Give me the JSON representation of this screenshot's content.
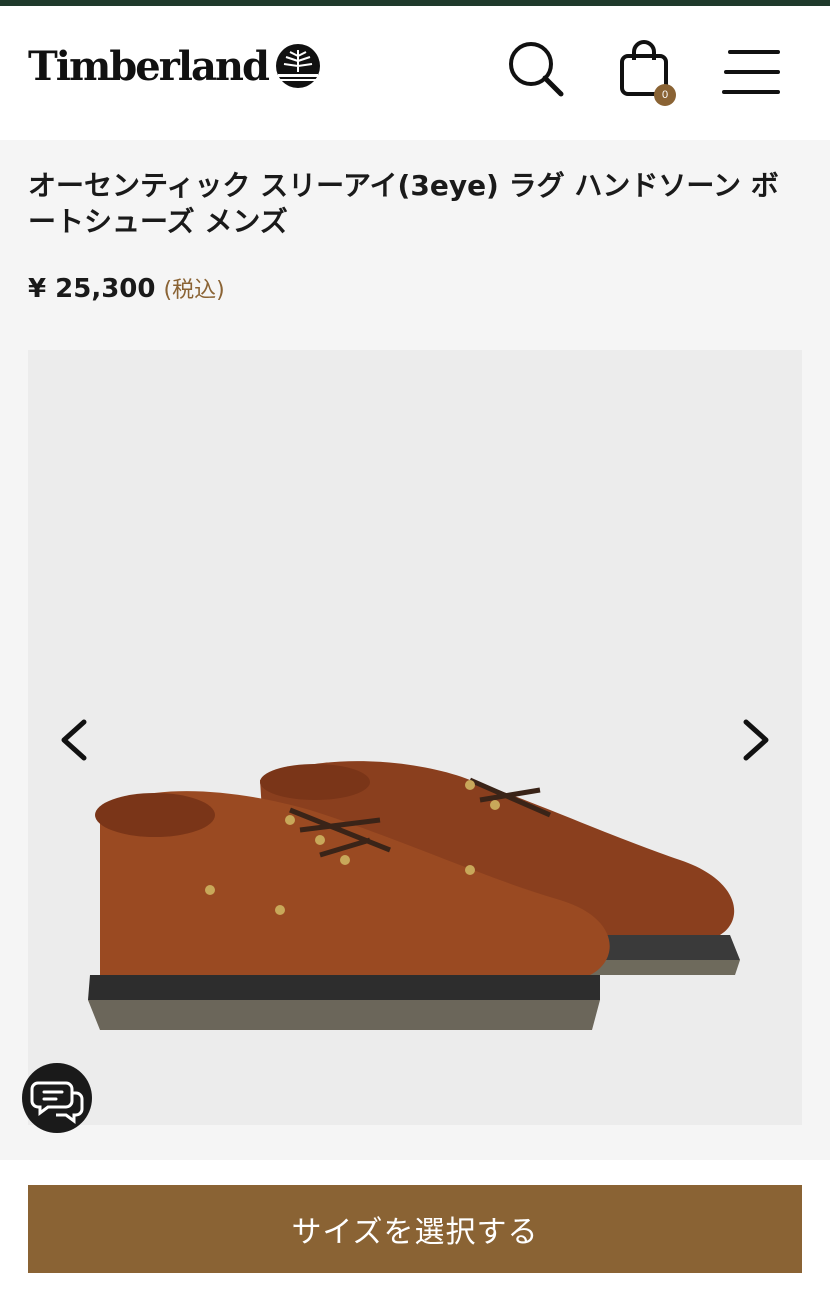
{
  "header": {
    "brand": "Timberland",
    "cart_count": "0",
    "icons": [
      "search-icon",
      "shopping-bag-icon",
      "menu-icon"
    ]
  },
  "product": {
    "title": "オーセンティック スリーアイ(3eye) ラグ ハンドソーン ボートシューズ メンズ",
    "price": "¥ 25,300",
    "tax_note": "(税込)"
  },
  "gallery": {
    "image_alt": "brown woven leather boat shoes",
    "prev_icon": "chevron-left-icon",
    "next_icon": "chevron-right-icon"
  },
  "chat": {
    "icon": "chat-icon"
  },
  "cta": {
    "label": "サイズを選択する"
  },
  "colors": {
    "accent": "#8a6334",
    "topbar": "#1f3a2b",
    "text": "#1a1a1a"
  }
}
